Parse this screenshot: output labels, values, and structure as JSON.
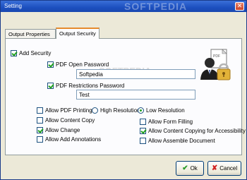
{
  "window": {
    "title": "Setting",
    "watermark": "SOFTPEDIA",
    "close_glyph": "✕"
  },
  "tabs": [
    {
      "label": "Output Properties",
      "active": false
    },
    {
      "label": "Output Security",
      "active": true
    }
  ],
  "panel": {
    "ghost_text": "SOFTPEDIA",
    "ghost_subtext": "www.softpedia.com",
    "add_security": {
      "label": "Add Security",
      "checked": true
    },
    "open_password": {
      "label": "PDF Open Password",
      "checked": true,
      "value": "Softpedia"
    },
    "restrictions_password": {
      "label": "PDF Restrictions Password",
      "checked": true,
      "value": "Test"
    },
    "icon": "pdf-lock-user-icon",
    "permissions": {
      "allow_pdf_printing": {
        "label": "Allow PDF Printing",
        "checked": false
      },
      "high_resolution": {
        "label": "High Resolution",
        "checked": false
      },
      "low_resolution": {
        "label": "Low Resolution",
        "checked": true
      },
      "allow_content_copy": {
        "label": "Allow Content Copy",
        "checked": false
      },
      "allow_form_filling": {
        "label": "Allow Form Filling",
        "checked": false
      },
      "allow_change": {
        "label": "Allow Change",
        "checked": true
      },
      "allow_content_copying_accessibility": {
        "label": "Allow Content Copying for Accessibility",
        "checked": true
      },
      "allow_add_annotations": {
        "label": "Allow Add Annotations",
        "checked": false
      },
      "allow_assemble_document": {
        "label": "Allow Assemble Document",
        "checked": false
      }
    }
  },
  "buttons": {
    "ok": {
      "label": "Ok",
      "icon": "checkmark-icon",
      "icon_glyph": "✔"
    },
    "cancel": {
      "label": "Cancel",
      "icon": "cross-icon",
      "icon_glyph": "✘"
    }
  }
}
